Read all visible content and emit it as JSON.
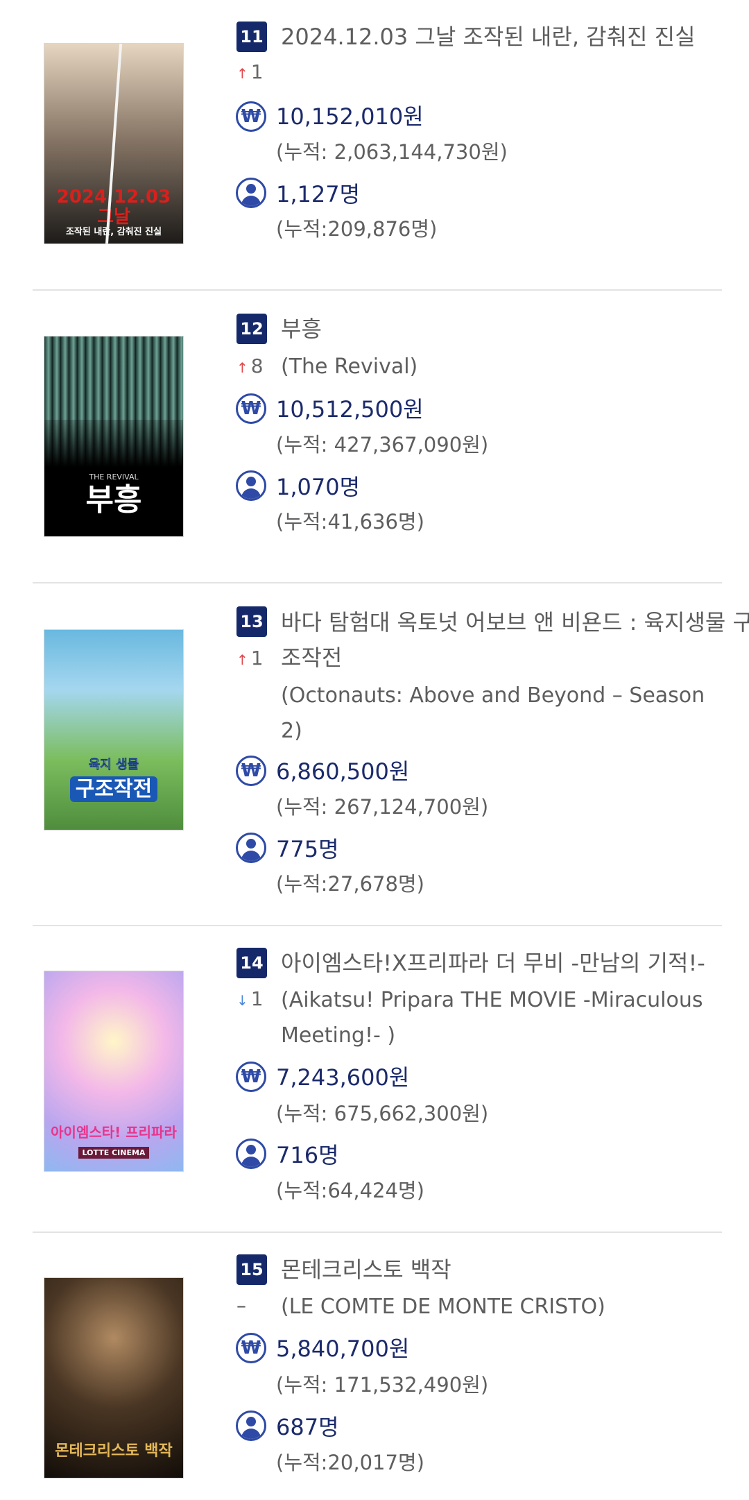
{
  "movies": [
    {
      "rank": "11",
      "title": "2024.12.03 그날 조작된 내란, 감춰진 진실",
      "change_dir": "up",
      "change_value": "1",
      "revenue": "10,152,010원",
      "revenue_total": "(누적: 2,063,144,730원)",
      "audience": "1,127명",
      "audience_total": "(누적:209,876명)",
      "poster_text": "2024.12.03 그날",
      "poster_sub": "조작된 내란, 감춰진 진실",
      "poster_colors": [
        "#e9d9c4",
        "#1c1a18"
      ]
    },
    {
      "rank": "12",
      "title": "부흥",
      "english_title": "(The Revival)",
      "change_dir": "up",
      "change_value": "8",
      "revenue": "10,512,500원",
      "revenue_total": "(누적: 427,367,090원)",
      "audience": "1,070명",
      "audience_total": "(누적:41,636명)",
      "poster_text": "부흥",
      "poster_sub": "THE REVIVAL",
      "poster_colors": [
        "#3f6b60",
        "#050505"
      ]
    },
    {
      "rank": "13",
      "title_line1": "바다 탐험대 옥토넛 어보브 앤 비욘드 : 육지생물 구",
      "title_line2": "조작전",
      "english_line1": "(Octonauts: Above and Beyond – Season",
      "english_line2": "2)",
      "change_dir": "up",
      "change_value": "1",
      "revenue": "6,860,500원",
      "revenue_total": "(누적: 267,124,700원)",
      "audience": "775명",
      "audience_total": "(누적:27,678명)",
      "poster_text": "구조작전",
      "poster_sub": "육지 생물",
      "poster_colors": [
        "#7cc6e8",
        "#5aa35a"
      ]
    },
    {
      "rank": "14",
      "title": "아이엠스타!X프리파라 더 무비 -만남의 기적!-",
      "english_line1": "(Aikatsu! Pripara THE MOVIE -Miraculous",
      "english_line2": "Meeting!- )",
      "change_dir": "down",
      "change_value": "1",
      "revenue": "7,243,600원",
      "revenue_total": "(누적: 675,662,300원)",
      "audience": "716명",
      "audience_total": "(누적:64,424명)",
      "poster_text": "아이엠스타! 프리파라",
      "poster_sub": "LOTTE CINEMA",
      "poster_colors": [
        "#c9b6f2",
        "#f5a9d6"
      ]
    },
    {
      "rank": "15",
      "title": "몬테크리스토 백작",
      "english_title": "(LE COMTE DE MONTE CRISTO)",
      "change_dir": "same",
      "change_value": "",
      "revenue": "5,840,700원",
      "revenue_total": "(누적: 171,532,490원)",
      "audience": "687명",
      "audience_total": "(누적:20,017명)",
      "poster_text": "몬테크리스토 백작",
      "poster_sub": "",
      "poster_colors": [
        "#3a2a1c",
        "#0e0a07"
      ]
    }
  ],
  "symbols": {
    "up": "↑",
    "down": "↓",
    "same": "–",
    "won": "₩"
  },
  "icons": {
    "revenue": "won-icon",
    "audience": "person-icon"
  }
}
